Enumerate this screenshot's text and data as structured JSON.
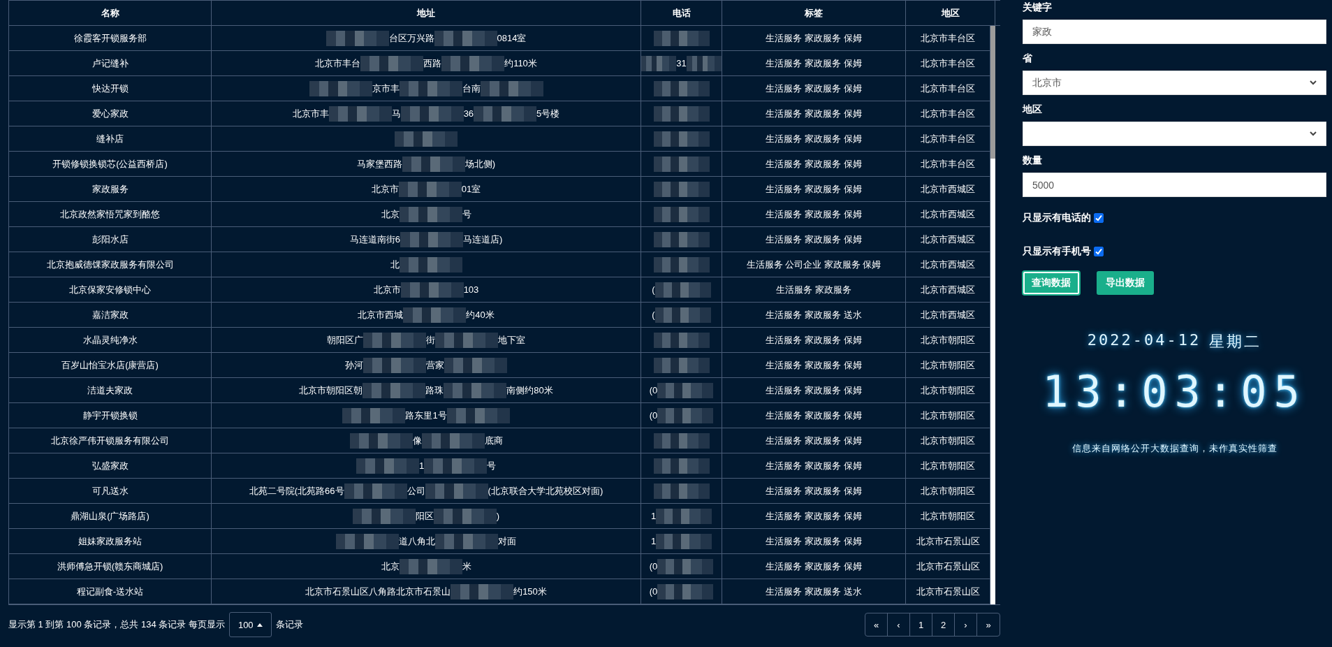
{
  "table": {
    "columns": [
      "名称",
      "地址",
      "电话",
      "标签",
      "地区"
    ],
    "rows": [
      {
        "name": "徐霞客开锁服务部",
        "address": [
          {
            "kind": "redacted"
          },
          {
            "kind": "text",
            "text": "台区万兴路"
          },
          {
            "kind": "redacted"
          },
          {
            "kind": "text",
            "text": "0814室"
          }
        ],
        "phone": [
          {
            "kind": "redacted"
          }
        ],
        "tags": "生活服务 家政服务 保姆",
        "region": "北京市丰台区"
      },
      {
        "name": "卢记缝补",
        "address": [
          {
            "kind": "text",
            "text": "北京市丰台"
          },
          {
            "kind": "redacted"
          },
          {
            "kind": "text",
            "text": "西路"
          },
          {
            "kind": "redacted"
          },
          {
            "kind": "text",
            "text": "约110米"
          }
        ],
        "phone": [
          {
            "kind": "redacted"
          },
          {
            "kind": "text",
            "text": "31"
          },
          {
            "kind": "redacted"
          }
        ],
        "tags": "生活服务 家政服务 保姆",
        "region": "北京市丰台区"
      },
      {
        "name": "快达开锁",
        "address": [
          {
            "kind": "redacted"
          },
          {
            "kind": "text",
            "text": "京市丰"
          },
          {
            "kind": "redacted"
          },
          {
            "kind": "text",
            "text": "台南"
          },
          {
            "kind": "redacted"
          }
        ],
        "phone": [
          {
            "kind": "redacted"
          }
        ],
        "tags": "生活服务 家政服务 保姆",
        "region": "北京市丰台区"
      },
      {
        "name": "爱心家政",
        "address": [
          {
            "kind": "text",
            "text": "北京市丰"
          },
          {
            "kind": "redacted"
          },
          {
            "kind": "text",
            "text": "马"
          },
          {
            "kind": "redacted"
          },
          {
            "kind": "text",
            "text": "36"
          },
          {
            "kind": "redacted"
          },
          {
            "kind": "text",
            "text": "5号楼"
          }
        ],
        "phone": [
          {
            "kind": "redacted"
          }
        ],
        "tags": "生活服务 家政服务 保姆",
        "region": "北京市丰台区"
      },
      {
        "name": "缝补店",
        "address": [
          {
            "kind": "redacted"
          }
        ],
        "phone": [
          {
            "kind": "redacted"
          }
        ],
        "tags": "生活服务 家政服务 保姆",
        "region": "北京市丰台区"
      },
      {
        "name": "开锁修锁换锁芯(公益西桥店)",
        "address": [
          {
            "kind": "text",
            "text": "马家堡西路"
          },
          {
            "kind": "redacted"
          },
          {
            "kind": "text",
            "text": "场北侧)"
          }
        ],
        "phone": [
          {
            "kind": "redacted"
          }
        ],
        "tags": "生活服务 家政服务 保姆",
        "region": "北京市丰台区"
      },
      {
        "name": "家政服务",
        "address": [
          {
            "kind": "text",
            "text": "北京市"
          },
          {
            "kind": "redacted"
          },
          {
            "kind": "text",
            "text": "01室"
          }
        ],
        "phone": [
          {
            "kind": "redacted"
          }
        ],
        "tags": "生活服务 家政服务 保姆",
        "region": "北京市西城区"
      },
      {
        "name": "北京政然家悟咒家到酪悠",
        "address": [
          {
            "kind": "text",
            "text": "北京"
          },
          {
            "kind": "redacted"
          },
          {
            "kind": "text",
            "text": "号"
          }
        ],
        "phone": [
          {
            "kind": "redacted"
          }
        ],
        "tags": "生活服务 家政服务 保姆",
        "region": "北京市西城区"
      },
      {
        "name": "彭阳水店",
        "address": [
          {
            "kind": "text",
            "text": "马连道南街6"
          },
          {
            "kind": "redacted"
          },
          {
            "kind": "text",
            "text": "马连道店)"
          }
        ],
        "phone": [
          {
            "kind": "redacted"
          }
        ],
        "tags": "生活服务 家政服务 保姆",
        "region": "北京市西城区"
      },
      {
        "name": "北京抱威德馃家政服务有限公司",
        "address": [
          {
            "kind": "text",
            "text": "北"
          },
          {
            "kind": "redacted"
          }
        ],
        "phone": [
          {
            "kind": "redacted"
          }
        ],
        "tags": "生活服务 公司企业 家政服务 保姆",
        "region": "北京市西城区"
      },
      {
        "name": "北京保家安修锁中心",
        "address": [
          {
            "kind": "text",
            "text": "北京市"
          },
          {
            "kind": "redacted"
          },
          {
            "kind": "text",
            "text": "103"
          }
        ],
        "phone": [
          {
            "kind": "text",
            "text": "("
          },
          {
            "kind": "redacted"
          }
        ],
        "tags": "生活服务 家政服务",
        "region": "北京市西城区"
      },
      {
        "name": "嘉洁家政",
        "address": [
          {
            "kind": "text",
            "text": "北京市西城"
          },
          {
            "kind": "redacted"
          },
          {
            "kind": "text",
            "text": "约40米"
          }
        ],
        "phone": [
          {
            "kind": "text",
            "text": "("
          },
          {
            "kind": "redacted"
          }
        ],
        "tags": "生活服务 家政服务 送水",
        "region": "北京市西城区"
      },
      {
        "name": "水晶灵纯净水",
        "address": [
          {
            "kind": "text",
            "text": "朝阳区广"
          },
          {
            "kind": "redacted"
          },
          {
            "kind": "text",
            "text": "街"
          },
          {
            "kind": "redacted"
          },
          {
            "kind": "text",
            "text": "地下室"
          }
        ],
        "phone": [
          {
            "kind": "redacted"
          }
        ],
        "tags": "生活服务 家政服务 保姆",
        "region": "北京市朝阳区"
      },
      {
        "name": "百岁山怡宝水店(康营店)",
        "address": [
          {
            "kind": "text",
            "text": "孙河"
          },
          {
            "kind": "redacted"
          },
          {
            "kind": "text",
            "text": "营家"
          },
          {
            "kind": "redacted"
          }
        ],
        "phone": [
          {
            "kind": "redacted"
          }
        ],
        "tags": "生活服务 家政服务 保姆",
        "region": "北京市朝阳区"
      },
      {
        "name": "洁道夫家政",
        "address": [
          {
            "kind": "text",
            "text": "北京市朝阳区朝"
          },
          {
            "kind": "redacted"
          },
          {
            "kind": "text",
            "text": "路珠"
          },
          {
            "kind": "redacted"
          },
          {
            "kind": "text",
            "text": "南侧约80米"
          }
        ],
        "phone": [
          {
            "kind": "text",
            "text": "(0"
          },
          {
            "kind": "redacted"
          }
        ],
        "tags": "生活服务 家政服务 保姆",
        "region": "北京市朝阳区"
      },
      {
        "name": "静宇开锁换锁",
        "address": [
          {
            "kind": "redacted"
          },
          {
            "kind": "text",
            "text": "路东里1号"
          },
          {
            "kind": "redacted"
          }
        ],
        "phone": [
          {
            "kind": "text",
            "text": "(0"
          },
          {
            "kind": "redacted"
          }
        ],
        "tags": "生活服务 家政服务 保姆",
        "region": "北京市朝阳区"
      },
      {
        "name": "北京徐严伟开锁服务有限公司",
        "address": [
          {
            "kind": "redacted"
          },
          {
            "kind": "text",
            "text": "像"
          },
          {
            "kind": "redacted"
          },
          {
            "kind": "text",
            "text": "底商"
          }
        ],
        "phone": [
          {
            "kind": "redacted"
          }
        ],
        "tags": "生活服务 家政服务 保姆",
        "region": "北京市朝阳区"
      },
      {
        "name": "弘盛家政",
        "address": [
          {
            "kind": "redacted"
          },
          {
            "kind": "text",
            "text": "1"
          },
          {
            "kind": "redacted"
          },
          {
            "kind": "text",
            "text": "号"
          }
        ],
        "phone": [
          {
            "kind": "redacted"
          }
        ],
        "tags": "生活服务 家政服务 保姆",
        "region": "北京市朝阳区"
      },
      {
        "name": "可凡送水",
        "address": [
          {
            "kind": "text",
            "text": "北苑二号院(北苑路66号"
          },
          {
            "kind": "redacted"
          },
          {
            "kind": "text",
            "text": "公司"
          },
          {
            "kind": "redacted"
          },
          {
            "kind": "text",
            "text": "(北京联合大学北苑校区对面)"
          }
        ],
        "phone": [
          {
            "kind": "redacted"
          }
        ],
        "tags": "生活服务 家政服务 保姆",
        "region": "北京市朝阳区"
      },
      {
        "name": "鼎湖山泉(广场路店)",
        "address": [
          {
            "kind": "redacted"
          },
          {
            "kind": "text",
            "text": "阳区"
          },
          {
            "kind": "redacted"
          },
          {
            "kind": "text",
            "text": ")"
          }
        ],
        "phone": [
          {
            "kind": "text",
            "text": "1"
          },
          {
            "kind": "redacted"
          }
        ],
        "tags": "生活服务 家政服务 保姆",
        "region": "北京市朝阳区"
      },
      {
        "name": "姐妹家政服务站",
        "address": [
          {
            "kind": "redacted"
          },
          {
            "kind": "text",
            "text": "道八角北"
          },
          {
            "kind": "redacted"
          },
          {
            "kind": "text",
            "text": "对面"
          }
        ],
        "phone": [
          {
            "kind": "text",
            "text": "1"
          },
          {
            "kind": "redacted"
          }
        ],
        "tags": "生活服务 家政服务 保姆",
        "region": "北京市石景山区"
      },
      {
        "name": "洪师傅急开锁(赣东商城店)",
        "address": [
          {
            "kind": "text",
            "text": "北京"
          },
          {
            "kind": "redacted"
          },
          {
            "kind": "text",
            "text": "米"
          }
        ],
        "phone": [
          {
            "kind": "text",
            "text": "(0"
          },
          {
            "kind": "redacted"
          }
        ],
        "tags": "生活服务 家政服务 保姆",
        "region": "北京市石景山区"
      },
      {
        "name": "程记副食-送水站",
        "address": [
          {
            "kind": "text",
            "text": "北京市石景山区八角路北京市石景山"
          },
          {
            "kind": "redacted"
          },
          {
            "kind": "text",
            "text": "约150米"
          }
        ],
        "phone": [
          {
            "kind": "text",
            "text": "(0"
          },
          {
            "kind": "redacted"
          }
        ],
        "tags": "生活服务 家政服务 送水",
        "region": "北京市石景山区"
      }
    ]
  },
  "footer": {
    "summary": "显示第 1 到第 100 条记录，总共 134 条记录 每页显示",
    "page_size": "100",
    "suffix": "条记录"
  },
  "pagination": [
    "«",
    "‹",
    "1",
    "2",
    "›",
    "»"
  ],
  "filters": {
    "keyword_label": "关键字",
    "keyword": "家政",
    "province_label": "省",
    "province": "北京市",
    "region_label": "地区",
    "count_label": "数量",
    "count": "5000",
    "checks": [
      {
        "label": "只显示有电话的",
        "checked": true
      },
      {
        "label": "只显示有手机号",
        "checked": true
      }
    ],
    "buttons": [
      {
        "label": "查询数据",
        "focused": true
      },
      {
        "label": "导出数据",
        "focused": false
      }
    ]
  },
  "clock": {
    "date": "2022-04-12",
    "weekday": "星期二",
    "time": "13:03:05",
    "note": "信息来自网络公开大数据查询，未作真实性筛查"
  }
}
